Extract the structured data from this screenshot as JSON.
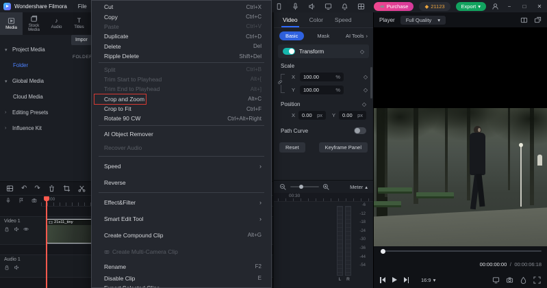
{
  "titlebar": {
    "app_name": "Wondershare Filmora",
    "file_menu": "File",
    "purchase": "Purchase",
    "points": "21123",
    "export": "Export"
  },
  "media_panel": {
    "tabs": [
      {
        "label": "Media"
      },
      {
        "label": "Stock Media"
      },
      {
        "label": "Audio"
      },
      {
        "label": "Titles"
      }
    ],
    "sidebar": [
      {
        "label": "Project Media"
      },
      {
        "label": "Folder"
      },
      {
        "label": "Global Media"
      },
      {
        "label": "Cloud Media"
      },
      {
        "label": "Editing Presets"
      },
      {
        "label": "Influence Kit"
      }
    ],
    "import_button": "Impor",
    "folder_header": "FOLDER"
  },
  "context_menu": {
    "items": [
      {
        "label": "Cut",
        "shortcut": "Ctrl+X"
      },
      {
        "label": "Copy",
        "shortcut": "Ctrl+C"
      },
      {
        "label": "Paste",
        "shortcut": "Ctrl+V",
        "disabled": true
      },
      {
        "label": "Duplicate",
        "shortcut": "Ctrl+D"
      },
      {
        "label": "Delete",
        "shortcut": "Del"
      },
      {
        "label": "Ripple Delete",
        "shortcut": "Shift+Del"
      },
      {
        "label": "Split",
        "shortcut": "Ctrl+B",
        "disabled": true
      },
      {
        "label": "Trim Start to Playhead",
        "shortcut": "Alt+[",
        "disabled": true
      },
      {
        "label": "Trim End to Playhead",
        "shortcut": "Alt+]",
        "disabled": true
      },
      {
        "label": "Crop and Zoom",
        "shortcut": "Alt+C",
        "highlighted": true
      },
      {
        "label": "Crop to Fit",
        "shortcut": "Ctrl+F"
      },
      {
        "label": "Rotate 90 CW",
        "shortcut": "Ctrl+Alt+Right"
      },
      {
        "label": "AI Object Remover",
        "shortcut": ""
      },
      {
        "label": "Recover Audio",
        "shortcut": "",
        "disabled": true
      },
      {
        "label": "Speed",
        "shortcut": "",
        "submenu": true
      },
      {
        "label": "Reverse",
        "shortcut": ""
      },
      {
        "label": "Effect&Filter",
        "shortcut": "",
        "submenu": true
      },
      {
        "label": "Smart Edit Tool",
        "shortcut": "",
        "submenu": true
      },
      {
        "label": "Create Compound Clip",
        "shortcut": "Alt+G"
      },
      {
        "label": "Create Multi-Camera Clip",
        "shortcut": "",
        "disabled": true
      },
      {
        "label": "Rename",
        "shortcut": "F2"
      },
      {
        "label": "Disable Clip",
        "shortcut": "E"
      },
      {
        "label": "Export Selected Clips",
        "shortcut": ""
      }
    ]
  },
  "properties": {
    "tabs": [
      "Video",
      "Color",
      "Speed"
    ],
    "subtabs": [
      "Basic",
      "Mask",
      "AI Tools"
    ],
    "transform": "Transform",
    "scale": "Scale",
    "x_label": "X",
    "y_label": "Y",
    "scale_x": "100.00",
    "scale_y": "100.00",
    "percent": "%",
    "position": "Position",
    "pos_x": "0.00",
    "pos_y": "0.00",
    "px": "px",
    "path_curve": "Path Curve",
    "reset": "Reset",
    "keyframe_panel": "Keyframe Panel"
  },
  "meter": {
    "label": "Meter",
    "time_tick": "00:30",
    "scale": [
      "-6",
      "-12",
      "-18",
      "-24",
      "-30",
      "-36",
      "-44",
      "-54"
    ],
    "left": "L",
    "right": "R"
  },
  "player": {
    "title": "Player",
    "quality": "Full Quality",
    "current_time": "00:00:00:00",
    "time_sep": "/",
    "duration": "00:00:06:18",
    "aspect": "16:9"
  },
  "timeline": {
    "ruler_start": "00:00",
    "video_track": "Video 1",
    "audio_track": "Audio 1",
    "clip_name": "21s11_tiny"
  },
  "icons": {
    "chevron_right": "›",
    "chevron_down": "▾",
    "chevron_up": "▴",
    "diamond": "◇",
    "gem": "◆",
    "minimize": "−",
    "maximize": "□",
    "close": "✕",
    "undo": "↶",
    "redo": "↷",
    "note": "♪",
    "titles": "T"
  },
  "colors": {
    "accent_blue": "#2f62e0",
    "toggle_teal": "#17b8ae",
    "purchase_pink": "#e8418c",
    "points_orange": "#eba43e",
    "export_green": "#12a35f",
    "highlight_red": "#d93a32",
    "playhead_red": "#ff5a4e"
  }
}
